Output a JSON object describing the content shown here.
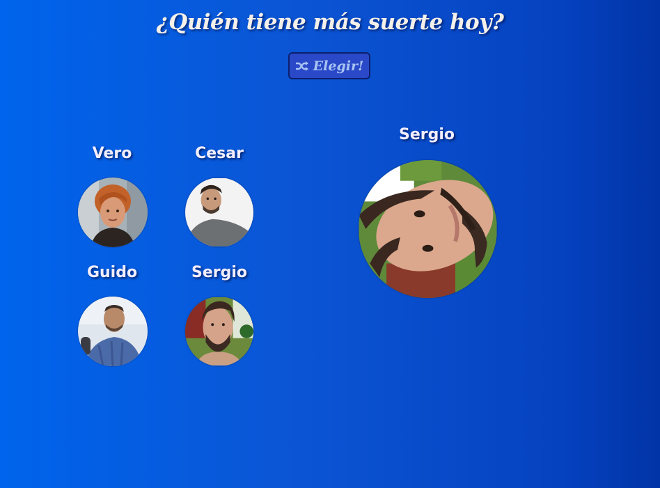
{
  "title": "¿Quién tiene más suerte hoy?",
  "pick_button": {
    "label": "Elegir!",
    "icon": "shuffle-icon"
  },
  "people": [
    {
      "name": "Vero"
    },
    {
      "name": "Cesar"
    },
    {
      "name": "Guido"
    },
    {
      "name": "Sergio"
    }
  ],
  "winner": {
    "name": "Sergio"
  },
  "colors": {
    "background_start": "#0064ec",
    "background_end": "#0134a6",
    "button_bg": "#2a49c8",
    "button_border": "#0c1f6e",
    "button_text": "#a9c4f2",
    "text": "#f4f0ea"
  }
}
